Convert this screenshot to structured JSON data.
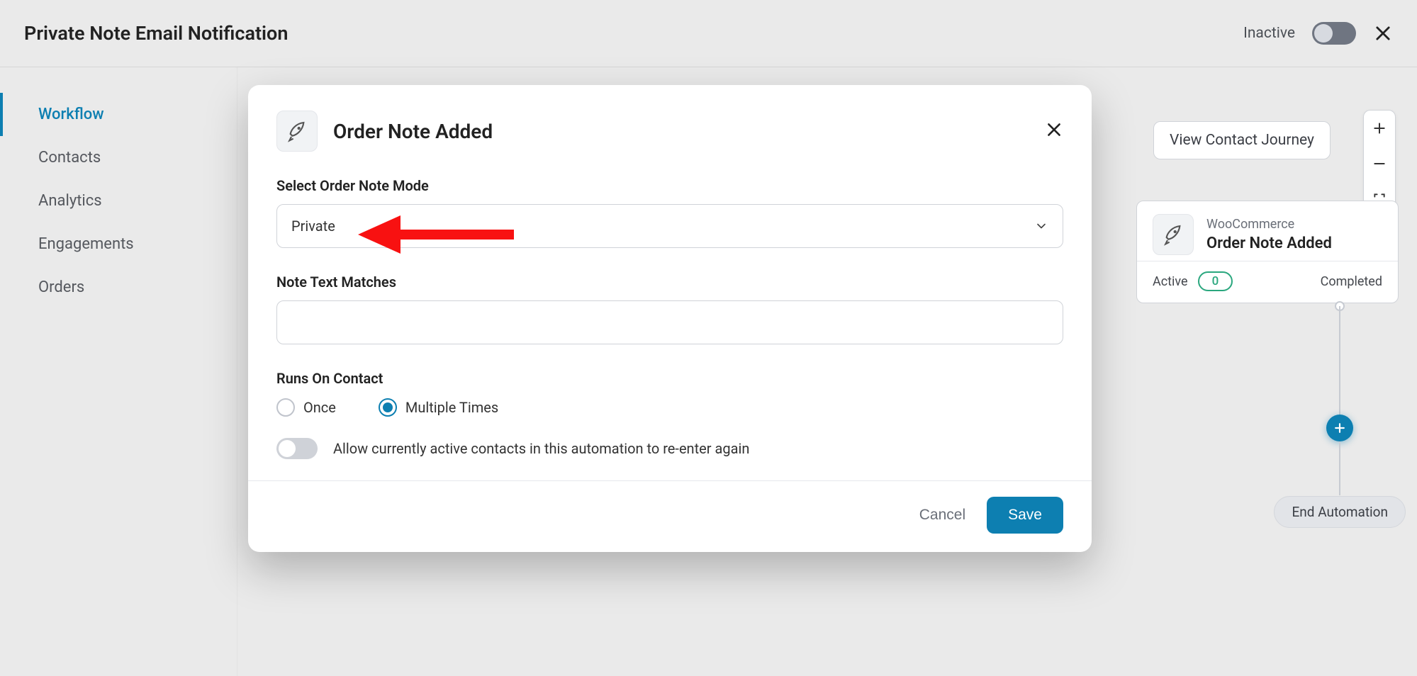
{
  "header": {
    "title": "Private Note Email Notification",
    "status": "Inactive"
  },
  "sidebar": {
    "items": [
      {
        "label": "Workflow",
        "active": true
      },
      {
        "label": "Contacts",
        "active": false
      },
      {
        "label": "Analytics",
        "active": false
      },
      {
        "label": "Engagements",
        "active": false
      },
      {
        "label": "Orders",
        "active": false
      }
    ]
  },
  "canvas": {
    "journey_button": "View Contact Journey",
    "trigger": {
      "source": "WooCommerce",
      "title": "Order Note Added",
      "active_label": "Active",
      "active_count": "0",
      "completed_label": "Completed"
    },
    "end_label": "End Automation"
  },
  "modal": {
    "title": "Order Note Added",
    "field_mode_label": "Select Order Note Mode",
    "mode_value": "Private",
    "field_text_label": "Note Text Matches",
    "text_value": "",
    "runs_label": "Runs On Contact",
    "radio_once": "Once",
    "radio_multiple": "Multiple Times",
    "radio_selected": "multiple",
    "reenter_label": "Allow currently active contacts in this automation to re-enter again",
    "cancel": "Cancel",
    "save": "Save"
  }
}
